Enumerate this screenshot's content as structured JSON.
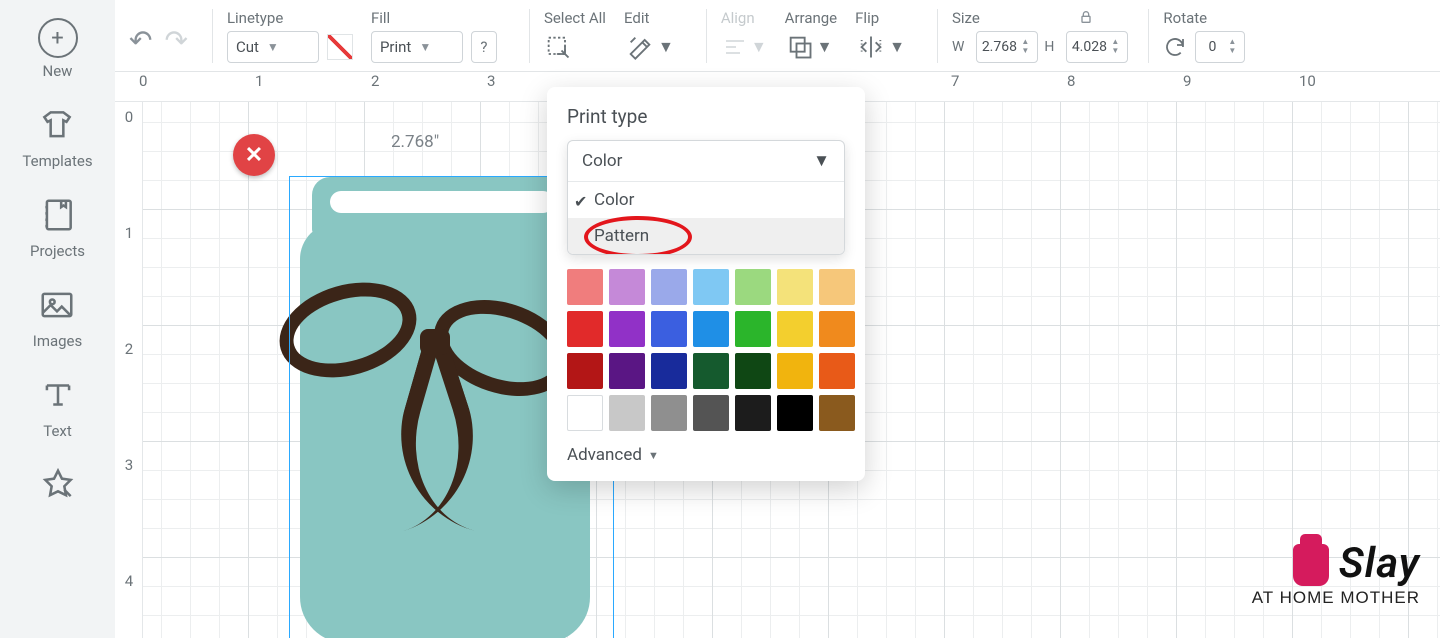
{
  "sidebar": {
    "items": [
      {
        "label": "New"
      },
      {
        "label": "Templates"
      },
      {
        "label": "Projects"
      },
      {
        "label": "Images"
      },
      {
        "label": "Text"
      }
    ]
  },
  "toolbar": {
    "linetype": {
      "label": "Linetype",
      "value": "Cut"
    },
    "fill": {
      "label": "Fill",
      "value": "Print",
      "help": "?"
    },
    "select_all": {
      "label": "Select All"
    },
    "edit": {
      "label": "Edit"
    },
    "align": {
      "label": "Align"
    },
    "arrange": {
      "label": "Arrange"
    },
    "flip": {
      "label": "Flip"
    },
    "size": {
      "label": "Size",
      "w_label": "W",
      "w_value": "2.768",
      "h_label": "H",
      "h_value": "4.028"
    },
    "rotate": {
      "label": "Rotate",
      "value": "0"
    }
  },
  "ruler": {
    "h": [
      "0",
      "1",
      "2",
      "3",
      "7",
      "8",
      "9",
      "10"
    ],
    "v": [
      "0",
      "1",
      "2",
      "3",
      "4"
    ]
  },
  "canvas": {
    "dim_label": "2.768\""
  },
  "popover": {
    "title": "Print type",
    "selected": "Color",
    "options": [
      {
        "label": "Color",
        "checked": true
      },
      {
        "label": "Pattern",
        "checked": false,
        "highlight": true
      }
    ],
    "colors": [
      "#f07d7d",
      "#c589d8",
      "#9aa9ea",
      "#7fc8f3",
      "#9bd97f",
      "#f4e27a",
      "#f6c77a",
      "#e12a2a",
      "#9131c7",
      "#3b5fe0",
      "#1f8fe6",
      "#2bb52b",
      "#f3cf2e",
      "#f08a1d",
      "#b31616",
      "#5a1684",
      "#182b9b",
      "#155a2e",
      "#0f4714",
      "#f1b40e",
      "#e85a18",
      "#ffffff",
      "#c8c8c8",
      "#8f8f8f",
      "#545454",
      "#1c1c1c",
      "#000000",
      "#8a5a1e"
    ],
    "advanced": "Advanced"
  },
  "watermark": {
    "top": "Slay",
    "bot": "AT HOME MOTHER"
  }
}
